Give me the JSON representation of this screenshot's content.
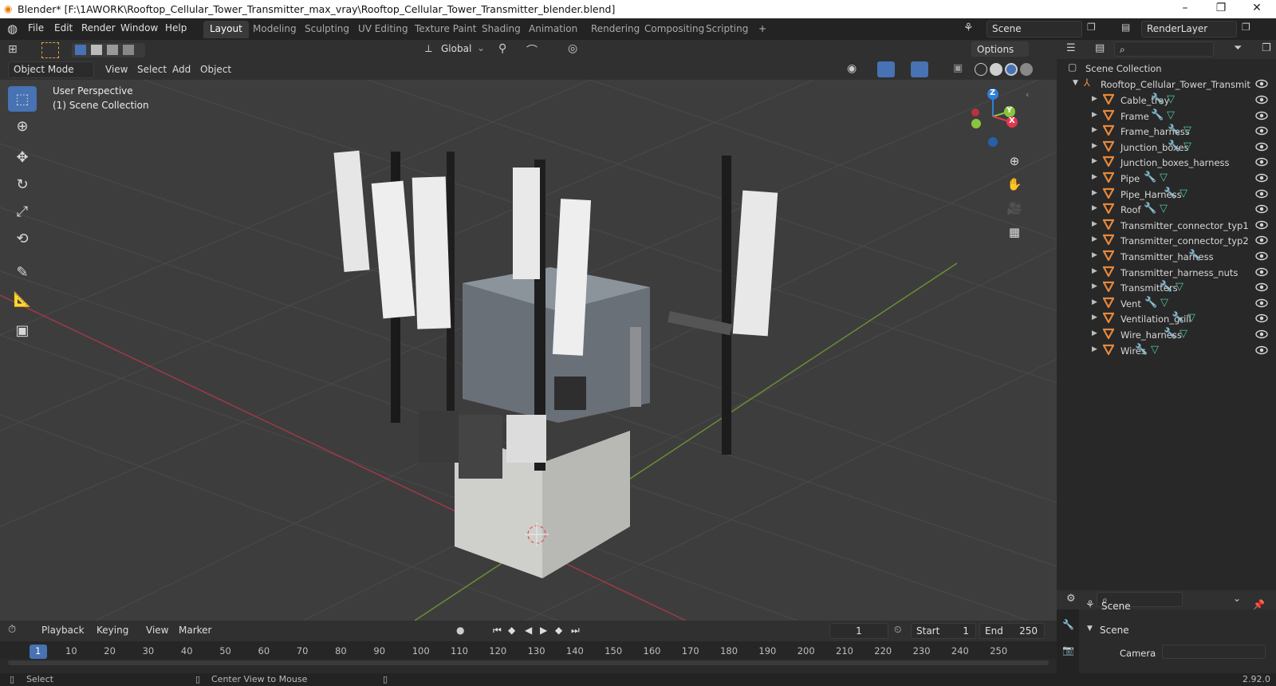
{
  "window": {
    "title": "Blender* [F:\\1AWORK\\Rooftop_Cellular_Tower_Transmitter_max_vray\\Rooftop_Cellular_Tower_Transmitter_blender.blend]",
    "minimize": "–",
    "maximize": "❐",
    "close": "✕"
  },
  "menu": [
    "File",
    "Edit",
    "Render",
    "Window",
    "Help"
  ],
  "workspaces": [
    "Layout",
    "Modeling",
    "Sculpting",
    "UV Editing",
    "Texture Paint",
    "Shading",
    "Animation",
    "Rendering",
    "Compositing",
    "Scripting",
    "+"
  ],
  "active_workspace": "Layout",
  "scene_field": "Scene",
  "renderlayer_field": "RenderLayer",
  "tool_header": {
    "orientation": "Global",
    "options": "Options"
  },
  "viewport_header": {
    "mode": "Object Mode",
    "menus": [
      "View",
      "Select",
      "Add",
      "Object"
    ]
  },
  "viewport": {
    "perspective": "User Perspective",
    "collection": "(1) Scene Collection",
    "gizmo": {
      "x": "X",
      "y": "Y",
      "z": "Z"
    }
  },
  "outliner": {
    "root": "Scene Collection",
    "parent": "Rooftop_Cellular_Tower_Transmit",
    "objects": [
      {
        "name": "Cable_tray",
        "mod": true,
        "mesh": true
      },
      {
        "name": "Frame",
        "mod": true,
        "mesh": true
      },
      {
        "name": "Frame_harness",
        "mod": true,
        "mesh": true
      },
      {
        "name": "Junction_boxes",
        "mod": true,
        "mesh": true
      },
      {
        "name": "Junction_boxes_harness",
        "mod": false,
        "mesh": false
      },
      {
        "name": "Pipe",
        "mod": true,
        "mesh": true
      },
      {
        "name": "Pipe_Harness",
        "mod": true,
        "mesh": true
      },
      {
        "name": "Roof",
        "mod": true,
        "mesh": true
      },
      {
        "name": "Transmitter_connector_typ1",
        "mod": false,
        "mesh": false
      },
      {
        "name": "Transmitter_connector_typ2",
        "mod": false,
        "mesh": false
      },
      {
        "name": "Transmitter_harness",
        "mod": true,
        "mesh": false
      },
      {
        "name": "Transmitter_harness_nuts",
        "mod": false,
        "mesh": false
      },
      {
        "name": "Transmitters",
        "mod": true,
        "mesh": true
      },
      {
        "name": "Vent",
        "mod": true,
        "mesh": true
      },
      {
        "name": "Ventilation_grill",
        "mod": true,
        "mesh": true
      },
      {
        "name": "Wire_harness",
        "mod": true,
        "mesh": true
      },
      {
        "name": "Wires",
        "mod": true,
        "mesh": true
      }
    ]
  },
  "properties": {
    "title": "Scene",
    "section": "Scene",
    "camera_label": "Camera"
  },
  "timeline": {
    "menus": [
      "Playback",
      "Keying",
      "View",
      "Marker"
    ],
    "current_frame": "1",
    "start_label": "Start",
    "start": "1",
    "end_label": "End",
    "end": "250",
    "ruler": [
      "1",
      "10",
      "20",
      "30",
      "40",
      "50",
      "60",
      "70",
      "80",
      "90",
      "100",
      "110",
      "120",
      "130",
      "140",
      "150",
      "160",
      "170",
      "180",
      "190",
      "200",
      "210",
      "220",
      "230",
      "240",
      "250"
    ]
  },
  "status": {
    "left": "Select",
    "middle": "Center View to Mouse",
    "version": "2.92.0"
  },
  "colors": {
    "accent": "#4772b3",
    "object_icon": "#e5883b",
    "mesh_icon": "#4ec7a3",
    "modifier_icon": "#6fa8d8",
    "x_axis": "#e0384f",
    "y_axis": "#8bc43e",
    "z_axis": "#2f7fd6"
  }
}
